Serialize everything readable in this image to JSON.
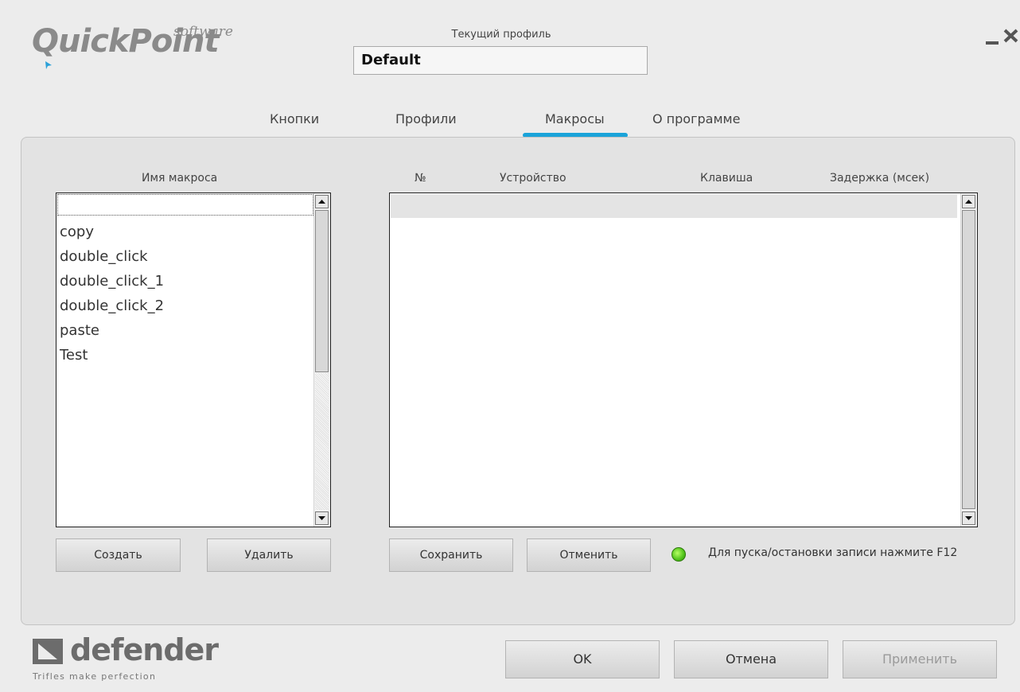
{
  "app": {
    "logo_text": "QuickPoint",
    "logo_suffix": "software",
    "profile_label": "Текущий профиль",
    "profile_value": "Default"
  },
  "tabs": [
    {
      "label": "Кнопки"
    },
    {
      "label": "Профили"
    },
    {
      "label": "Макросы",
      "active": true
    },
    {
      "label": "О программе"
    }
  ],
  "macros": {
    "header": "Имя макроса",
    "items": [
      "",
      "copy",
      "double_click",
      "double_click_1",
      "double_click_2",
      "paste",
      "Test"
    ],
    "create_label": "Создать",
    "delete_label": "Удалить"
  },
  "steps": {
    "columns": [
      "№",
      "Устройство",
      "Клавиша",
      "Задержка (мсек)"
    ],
    "rows": [],
    "save_label": "Сохранить",
    "cancel_label": "Отменить",
    "record_hint": "Для пуска/остановки записи нажмите F12"
  },
  "footer": {
    "brand": "defender",
    "tagline": "Trifles make perfection",
    "ok_label": "OK",
    "cancel_label": "Отмена",
    "apply_label": "Применить"
  },
  "colors": {
    "accent": "#1aa3d9",
    "record_led": "#4fc21a"
  },
  "icons": [
    "minimize-icon",
    "close-icon",
    "scroll-up-icon",
    "scroll-down-icon",
    "record-led-icon",
    "defender-logo-icon"
  ]
}
